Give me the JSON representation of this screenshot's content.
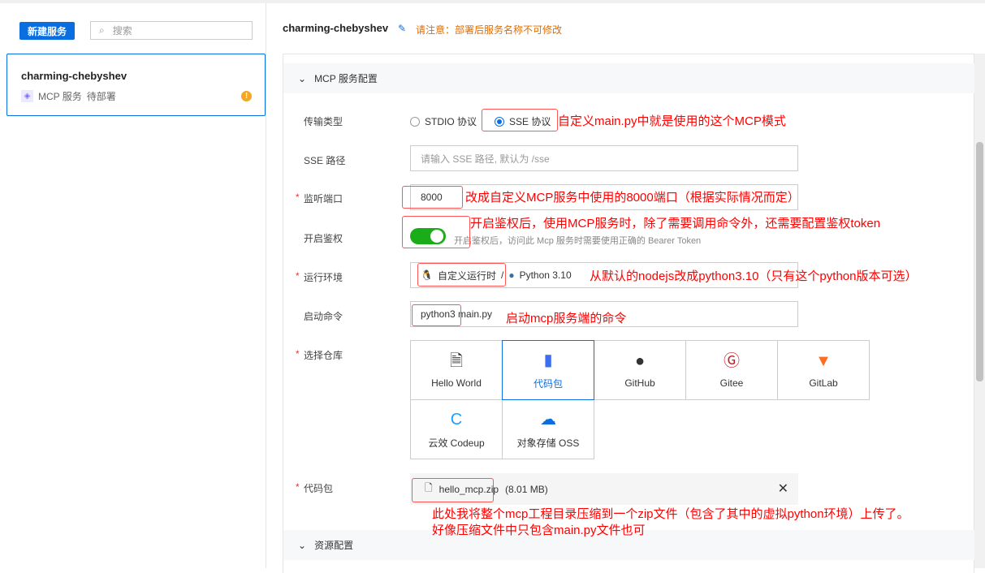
{
  "sidebar": {
    "new_button": "新建服务",
    "search_placeholder": "搜索",
    "card": {
      "name": "charming-chebyshev",
      "type": "MCP 服务",
      "status": "待部署"
    }
  },
  "header": {
    "title": "charming-chebyshev",
    "notice": "请注意：部署后服务名称不可修改"
  },
  "sections": {
    "mcp": "MCP 服务配置",
    "resource": "资源配置"
  },
  "form": {
    "transport": {
      "label": "传输类型",
      "options": [
        "STDIO 协议",
        "SSE 协议"
      ],
      "selected": "SSE 协议"
    },
    "sse_path": {
      "label": "SSE 路径",
      "placeholder": "请输入 SSE 路径, 默认为 /sse"
    },
    "port": {
      "label": "监听端口",
      "value": "8000"
    },
    "auth": {
      "label": "开启鉴权",
      "enabled": true,
      "hint": "开启鉴权后，访问此 Mcp 服务时需要使用正确的 Bearer Token"
    },
    "runtime": {
      "label": "运行环境",
      "value1": "自定义运行时",
      "sep": "/",
      "value2": "Python 3.10"
    },
    "command": {
      "label": "启动命令",
      "value": "python3 main.py"
    },
    "repo": {
      "label": "选择仓库",
      "options": [
        "Hello World",
        "代码包",
        "GitHub",
        "Gitee",
        "GitLab",
        "云效 Codeup",
        "对象存储 OSS"
      ],
      "selected": "代码包"
    },
    "package": {
      "label": "代码包",
      "file": "hello_mcp.zip",
      "size": "(8.01 MB)"
    }
  },
  "annotations": {
    "sse": "自定义main.py中就是使用的这个MCP模式",
    "port": "改成自定义MCP服务中使用的8000端口（根据实际情况而定）",
    "auth": "开启鉴权后，使用MCP服务时，除了需要调用命令外，还需要配置鉴权token",
    "runtime": "从默认的nodejs改成python3.10（只有这个python版本可选）",
    "command": "启动mcp服务端的命令",
    "package1": "此处我将整个mcp工程目录压缩到一个zip文件（包含了其中的虚拟python环境）上传了。",
    "package2": "好像压缩文件中只包含main.py文件也可"
  }
}
